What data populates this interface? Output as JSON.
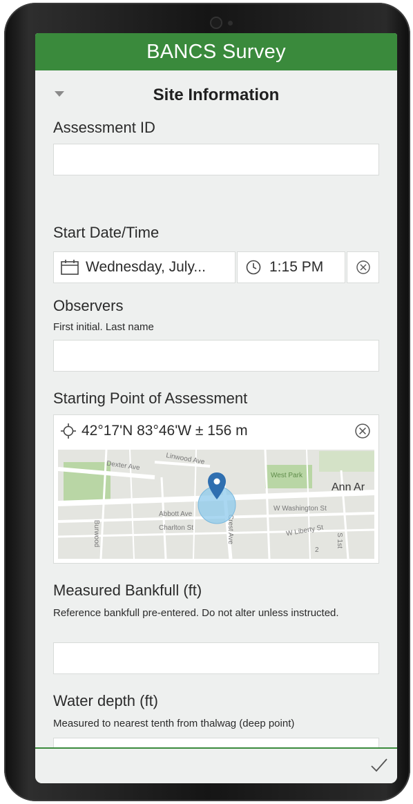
{
  "app": {
    "title": "BANCS Survey"
  },
  "group": {
    "title": "Site Information"
  },
  "fields": {
    "assessment_id": {
      "label": "Assessment ID",
      "value": ""
    },
    "start_datetime": {
      "label": "Start Date/Time",
      "date": "Wednesday, July...",
      "time": "1:15 PM"
    },
    "observers": {
      "label": "Observers",
      "hint": "First initial. Last name",
      "value": ""
    },
    "starting_point": {
      "label": "Starting Point of Assessment",
      "coordinates": "42°17'N 83°46'W ± 156 m",
      "map": {
        "labels": [
          "Dexter Ave",
          "Linwood Ave",
          "West Park",
          "Ann Ar",
          "W Washington St",
          "Abbott Ave",
          "Charlton St",
          "Crest Ave",
          "W Liberty St",
          "Burwood",
          "S 1st",
          "2"
        ]
      }
    },
    "measured_bankfull": {
      "label": "Measured Bankfull (ft)",
      "hint": "Reference bankfull pre-entered. Do not alter unless instructed.",
      "value": ""
    },
    "water_depth": {
      "label": "Water depth (ft)",
      "hint": "Measured to nearest tenth from thalwag (deep point)",
      "value": ""
    }
  },
  "icons": {
    "collapse": "triangle-down-icon",
    "calendar": "calendar-icon",
    "clock": "clock-icon",
    "clear": "clear-circle-icon",
    "location": "crosshair-icon",
    "marker": "map-marker-icon",
    "submit": "checkmark-icon"
  },
  "colors": {
    "header": "#3a8a3c",
    "background": "#eef0ef",
    "marker": "#2f6fb0"
  }
}
